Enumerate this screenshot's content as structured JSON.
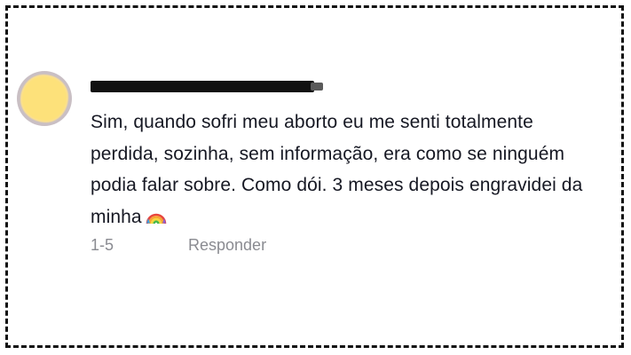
{
  "comment": {
    "username": "",
    "text": "Sim, quando sofri meu aborto eu me senti totalmente perdida, sozinha, sem informação, era como se ninguém podia falar sobre. Como dói. 3 meses depois engravidei da minha",
    "emoji": "rainbow-emoji",
    "date": "1-5",
    "reply_label": "Responder"
  },
  "colors": {
    "text": "#161823",
    "meta": "#8a8b91",
    "avatar_fill": "#fde17a",
    "frame_border": "#111111"
  }
}
